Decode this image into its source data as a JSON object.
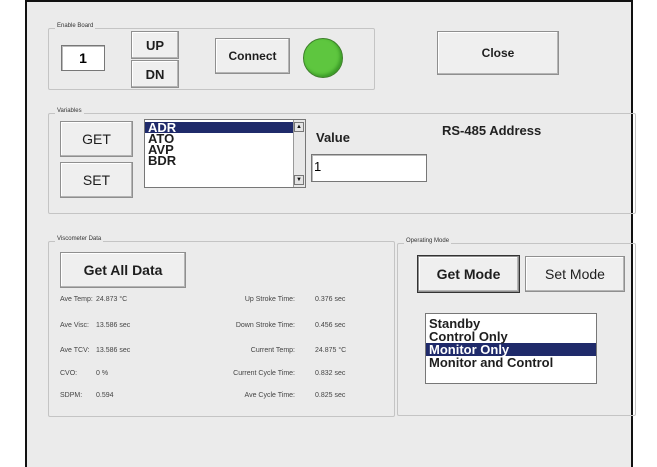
{
  "enable_board": {
    "legend": "Enable Board",
    "board_value": "1",
    "up_label": "UP",
    "dn_label": "DN",
    "connect_label": "Connect",
    "close_label": "Close",
    "status_color": "#5ec63f"
  },
  "variables": {
    "legend": "Variables",
    "get_label": "GET",
    "set_label": "SET",
    "list_items": [
      "ADR",
      "ATO",
      "AVP",
      "BDR"
    ],
    "selected_item": "ADR",
    "value_label": "Value",
    "value": "1",
    "description": "RS-485 Address"
  },
  "viscometer": {
    "legend": "Viscometer Data",
    "get_all_label": "Get All Data",
    "left": [
      {
        "label": "Ave Temp:",
        "value": "24.873 °C"
      },
      {
        "label": "Ave Visc:",
        "value": "13.586 sec"
      },
      {
        "label": "Ave TCV:",
        "value": "13.586 sec"
      },
      {
        "label": "CVO:",
        "value": "0 %"
      },
      {
        "label": "SDPM:",
        "value": "0.594"
      }
    ],
    "right": [
      {
        "label": "Up Stroke Time:",
        "value": "0.376 sec"
      },
      {
        "label": "Down Stroke Time:",
        "value": "0.456 sec"
      },
      {
        "label": "Current Temp:",
        "value": "24.875 °C"
      },
      {
        "label": "Current Cycle Time:",
        "value": "0.832 sec"
      },
      {
        "label": "Ave Cycle Time:",
        "value": "0.825 sec"
      }
    ]
  },
  "operating_mode": {
    "legend": "Operating Mode",
    "get_mode_label": "Get Mode",
    "set_mode_label": "Set Mode",
    "modes": [
      "Standby",
      "Control Only",
      "Monitor Only",
      "Monitor and Control"
    ],
    "selected_mode": "Monitor Only"
  },
  "colors": {
    "selection": "#1f2a6a",
    "background": "#ebebeb"
  }
}
